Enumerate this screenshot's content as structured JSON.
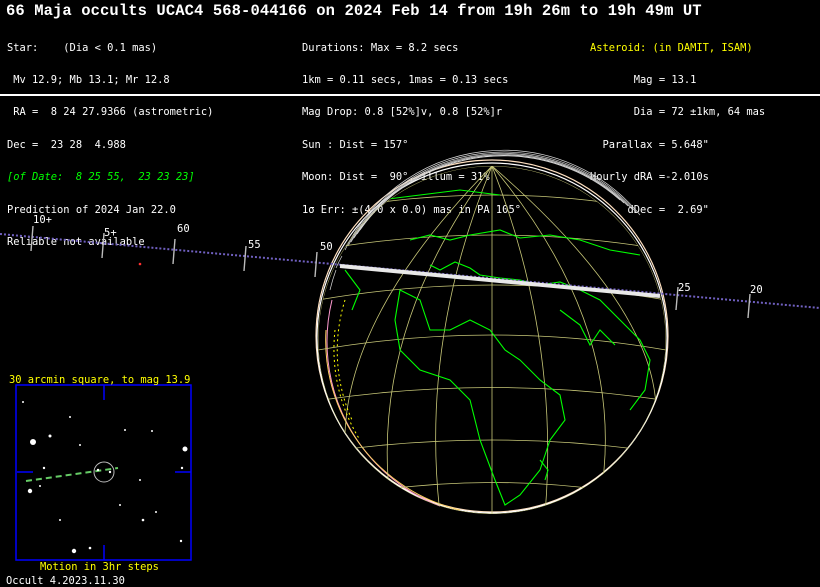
{
  "title": "66 Maja occults UCAC4 568-044166 on 2024 Feb 14 from 19h 26m to 19h 49m UT",
  "star_block": [
    "Star:    (Dia < 0.1 mas)",
    " Mv 12.9; Mb 13.1; Mr 12.8",
    " RA =  8 24 27.9366 (astrometric)",
    "Dec =  23 28  4.988",
    "[of Date:  8 25 55,  23 23 23]",
    "Prediction of 2024 Jan 22.0",
    "Reliable not available"
  ],
  "event_block": [
    "Durations: Max = 8.2 secs",
    "1km = 0.11 secs, 1mas = 0.13 secs",
    "Mag Drop: 0.8 [52%]v, 0.8 [52%]r",
    "Sun : Dist = 157°",
    "Moon: Dist =  90°, illum = 31%",
    "1σ Err: ±(4.0 x 0.0) mas in PA 105°"
  ],
  "asteroid_block": {
    "header": "Asteroid: (in DAMIT, ISAM)",
    "lines": [
      "       Mag = 13.1",
      "       Dia = 72 ±1km, 64 mas",
      "  Parallax = 5.648\"",
      "Hourly dRA =-2.010s",
      "      dDec =  2.69\""
    ]
  },
  "time_ticks": [
    "10+",
    "5+",
    "60",
    "55",
    "50",
    "25",
    "20"
  ],
  "finder": {
    "title": "30 arcmin square, to mag 13.9",
    "caption": "Motion in 3hr steps"
  },
  "version": "Occult 4.2023.11.30",
  "colors": {
    "background": "#000000",
    "text": "#ffffff",
    "highlight": "#ffff00",
    "italic_green": "#00ff00",
    "coastline": "#00ff00",
    "grid": "#c8c878",
    "path": "#7060c0",
    "finder_box": "#0000ff"
  }
}
